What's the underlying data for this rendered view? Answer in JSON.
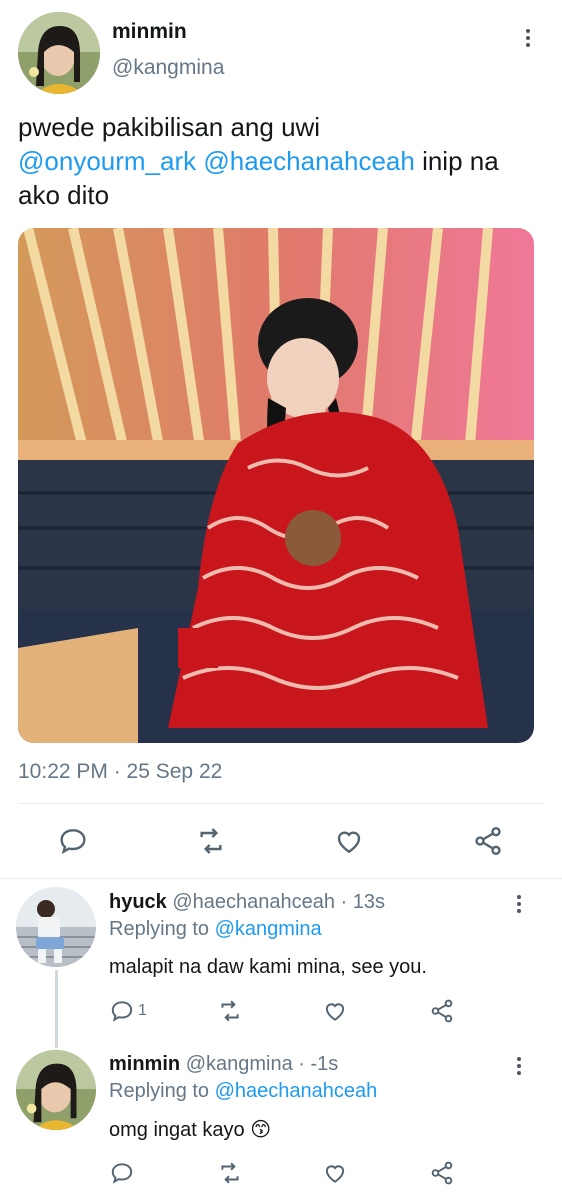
{
  "main_tweet": {
    "display_name": "minmin",
    "handle": "@kangmina",
    "text_part1": "pwede pakibilisan ang uwi",
    "mention1": "@onyourm_ark",
    "mention2": "@haechanahceah",
    "text_part2": "inip na",
    "text_part3": "ako dito",
    "timestamp": "10:22 PM · 25 Sep 22"
  },
  "replies": [
    {
      "display_name": "hyuck",
      "handle": "@haechanahceah",
      "time": "· 13s",
      "replying_prefix": "Replying to",
      "replying_to": "@kangmina",
      "text": "malapit na daw kami mina, see you.",
      "reply_count": "1"
    },
    {
      "display_name": "minmin",
      "handle": "@kangmina",
      "time": "· -1s",
      "replying_prefix": "Replying to",
      "replying_to": "@haechanahceah",
      "text": "omg ingat kayo 😙",
      "reply_count": ""
    }
  ],
  "icons": [
    "reply-icon",
    "retweet-icon",
    "like-icon",
    "share-icon",
    "more-icon"
  ],
  "colors": {
    "link": "#1d9bf0",
    "muted": "#657786",
    "icon": "#536471",
    "sweater": "#c8161c"
  }
}
